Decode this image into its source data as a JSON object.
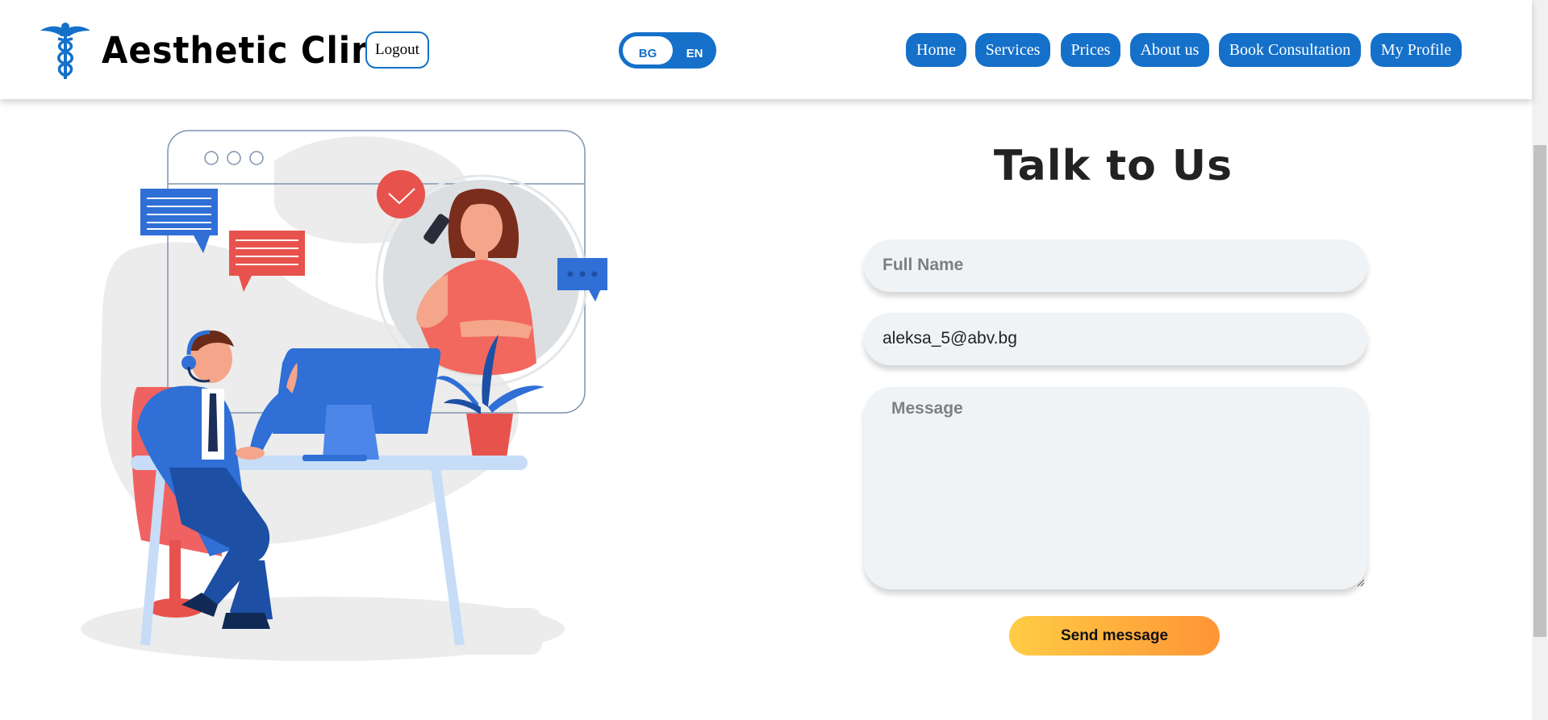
{
  "header": {
    "brand": "Aesthetic Clinic",
    "logo_icon": "caduceus-icon",
    "logout_label": "Logout",
    "language": {
      "bg": "BG",
      "en": "EN",
      "selected": "BG"
    },
    "nav": [
      "Home",
      "Services",
      "Prices",
      "About us",
      "Book Consultation",
      "My Profile"
    ]
  },
  "contact": {
    "title": "Talk to Us",
    "full_name_placeholder": "Full Name",
    "email_value": "aleksa_5@abv.bg",
    "message_placeholder": "Message",
    "send_label": "Send message"
  },
  "colors": {
    "primary": "#1570c9",
    "button_gradient_start": "#ffcc44",
    "button_gradient_end": "#ff9436",
    "field_bg": "#f0f3f6",
    "accent_red": "#e8524d",
    "accent_blue": "#2f6fd6"
  }
}
